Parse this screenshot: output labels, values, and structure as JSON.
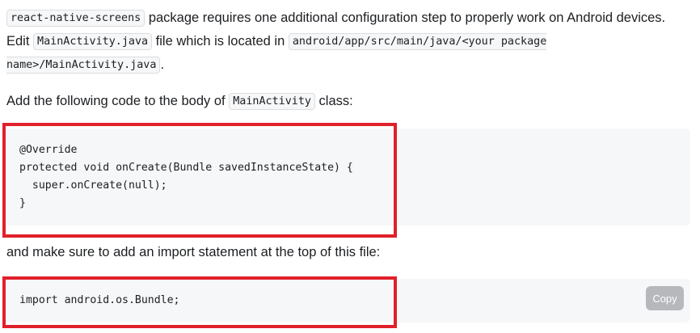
{
  "intro": {
    "code_package": "react-native-screens",
    "text_1": " package requires one additional configuration step to properly work on Android devices. Edit ",
    "code_file": "MainActivity.java",
    "text_2": " file which is located in ",
    "code_path": "android/app/src/main/java/<your package name>/MainActivity.java",
    "text_3": "."
  },
  "instruction_1": {
    "text_before": "Add the following code to the body of ",
    "code_class": "MainActivity",
    "text_after": " class:"
  },
  "code_block_1": {
    "code": "@Override\nprotected void onCreate(Bundle savedInstanceState) {\n  super.onCreate(null);\n}"
  },
  "instruction_2": {
    "text": "and make sure to add an import statement at the top of this file:"
  },
  "code_block_2": {
    "code": "import android.os.Bundle;",
    "copy_label": "Copy"
  },
  "colors": {
    "highlight": "#e0202a",
    "code_background": "#f6f7f8",
    "copy_button": "#b6b8bc"
  }
}
